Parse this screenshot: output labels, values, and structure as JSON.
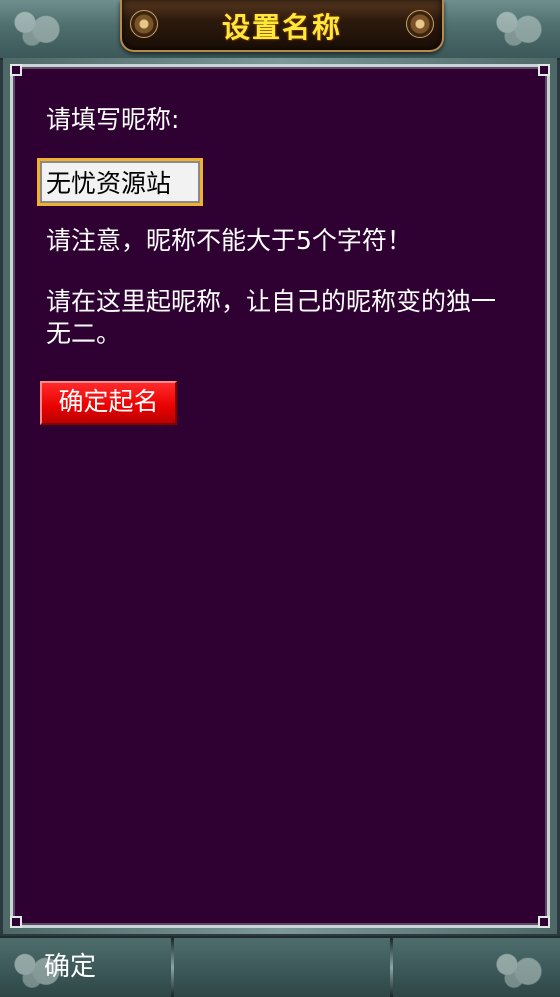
{
  "header": {
    "title": "设置名称"
  },
  "form": {
    "prompt": "请填写昵称:",
    "nickname_value": "无忧资源站",
    "warning": "请注意，昵称不能大于5个字符！",
    "hint": "请在这里起昵称，让自己的昵称变的独一无二。",
    "confirm_name_label": "确定起名"
  },
  "footer": {
    "ok_label": "确定"
  },
  "colors": {
    "panel_bg": "#2e0132",
    "title_text": "#ffe83a",
    "confirm_button": "#e80000",
    "input_border": "#f0b030"
  }
}
